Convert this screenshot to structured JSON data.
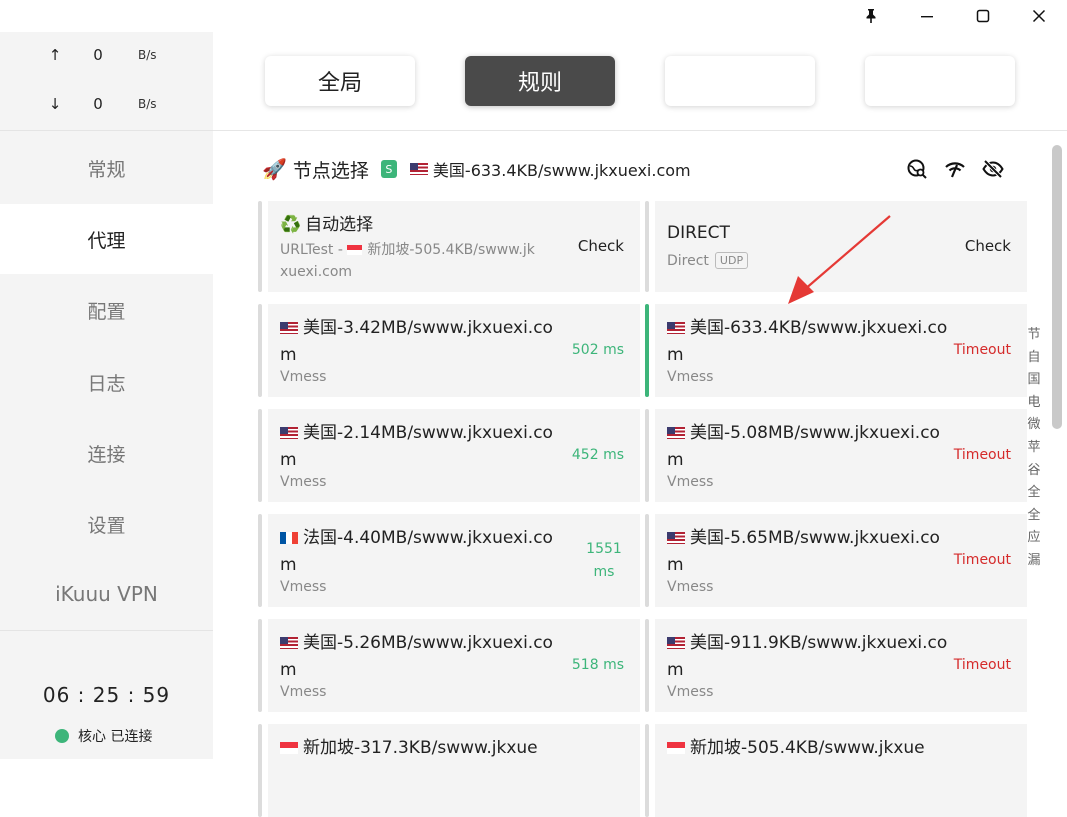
{
  "window_controls": [
    "pin-icon",
    "minimize-icon",
    "maximize-icon",
    "close-icon"
  ],
  "traffic": {
    "up": {
      "arrow": "↑",
      "value": "0",
      "unit": "B/s"
    },
    "down": {
      "arrow": "↓",
      "value": "0",
      "unit": "B/s"
    }
  },
  "sidebar": {
    "items": [
      {
        "label": "常规"
      },
      {
        "label": "代理"
      },
      {
        "label": "配置"
      },
      {
        "label": "日志"
      },
      {
        "label": "连接"
      },
      {
        "label": "设置"
      },
      {
        "label": "iKuuu VPN"
      }
    ],
    "active": "代理",
    "clock": "06 : 25 : 59",
    "status": "核心 已连接"
  },
  "modes": [
    {
      "label": "全局",
      "active": false
    },
    {
      "label": "规则",
      "active": true
    },
    {
      "label": "",
      "active": false
    },
    {
      "label": "",
      "active": false
    }
  ],
  "group": {
    "icon": "🚀",
    "title": "节点选择",
    "badge": "S",
    "selected_flag": "us",
    "selected": "美国-633.4KB/swww.jkxuexi.com",
    "actions": [
      "location-search-icon",
      "wifi-test-icon",
      "eye-off-icon"
    ]
  },
  "proxies": [
    {
      "icon": "♻️",
      "name": "自动选择",
      "sub_prefix": "URLTest - ",
      "sub_flag": "sg",
      "sub": "新加坡-505.4KB/swww.jkxuexi.com",
      "delay": "Check",
      "status": "check"
    },
    {
      "name": "DIRECT",
      "type": "Direct",
      "udp": "UDP",
      "delay": "Check",
      "status": "check"
    },
    {
      "flag": "us",
      "name": "美国-3.42MB/swww.jkxuexi.com",
      "type": "Vmess",
      "delay": "502 ms",
      "status": "ok"
    },
    {
      "flag": "us",
      "name": "美国-633.4KB/swww.jkxuexi.com",
      "type": "Vmess",
      "delay": "Timeout",
      "status": "bad",
      "selected": true
    },
    {
      "flag": "us",
      "name": "美国-2.14MB/swww.jkxuexi.com",
      "type": "Vmess",
      "delay": "452 ms",
      "status": "ok"
    },
    {
      "flag": "us",
      "name": "美国-5.08MB/swww.jkxuexi.com",
      "type": "Vmess",
      "delay": "Timeout",
      "status": "bad"
    },
    {
      "flag": "fr",
      "name": "法国-4.40MB/swww.jkxuexi.com",
      "type": "Vmess",
      "delay": "1551 ms",
      "status": "ok"
    },
    {
      "flag": "us",
      "name": "美国-5.65MB/swww.jkxuexi.com",
      "type": "Vmess",
      "delay": "Timeout",
      "status": "bad"
    },
    {
      "flag": "us",
      "name": "美国-5.26MB/swww.jkxuexi.com",
      "type": "Vmess",
      "delay": "518 ms",
      "status": "ok"
    },
    {
      "flag": "us",
      "name": "美国-911.9KB/swww.jkxuexi.com",
      "type": "Vmess",
      "delay": "Timeout",
      "status": "bad"
    },
    {
      "flag": "sg",
      "name": "新加坡-317.3KB/swww.jkxue",
      "type": "",
      "delay": "",
      "status": "ok"
    },
    {
      "flag": "sg",
      "name": "新加坡-505.4KB/swww.jkxue",
      "type": "",
      "delay": "",
      "status": "ok"
    }
  ],
  "index_letters": [
    "节",
    "自",
    "国",
    "电",
    "微",
    "苹",
    "谷",
    "全",
    "全",
    "应",
    "漏"
  ],
  "colors": {
    "accent": "#3db57a",
    "timeout": "#d52b2b",
    "active_mode": "#4a4a4a",
    "annotation_arrow": "#e53935"
  }
}
